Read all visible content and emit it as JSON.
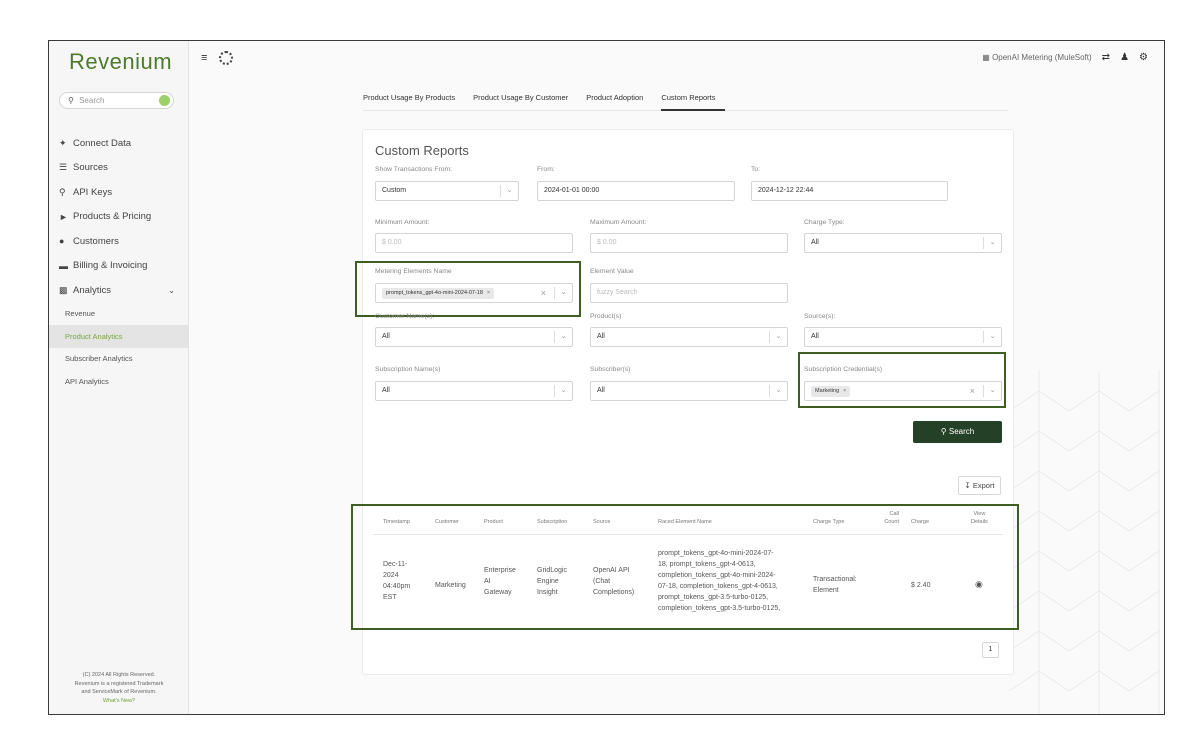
{
  "sidebar": {
    "logo": "Revenium",
    "search_placeholder": "Search",
    "items": [
      {
        "label": "Connect Data",
        "icon": "plug-icon"
      },
      {
        "label": "Sources",
        "icon": "database-icon"
      },
      {
        "label": "API Keys",
        "icon": "key-icon"
      },
      {
        "label": "Products & Pricing",
        "icon": "tag-icon"
      },
      {
        "label": "Customers",
        "icon": "users-icon"
      },
      {
        "label": "Billing & Invoicing",
        "icon": "credit-card-icon"
      },
      {
        "label": "Analytics",
        "icon": "bar-chart-icon"
      }
    ],
    "subitems": [
      {
        "label": "Revenue"
      },
      {
        "label": "Product Analytics",
        "active": true
      },
      {
        "label": "Subscriber Analytics"
      },
      {
        "label": "API Analytics"
      }
    ],
    "footer": {
      "line1": "(C) 2024 All Rights Reserved.",
      "line2": "Revenium is a registered Trademark",
      "line3": "and ServiceMark of Revenium.",
      "whats_new": "What's New?"
    }
  },
  "topbar": {
    "org_label": "OpenAI Metering (MuleSoft)"
  },
  "tabs": [
    {
      "label": "Product Usage By Products"
    },
    {
      "label": "Product Usage By Customer"
    },
    {
      "label": "Product Adoption"
    },
    {
      "label": "Custom Reports",
      "active": true
    }
  ],
  "report": {
    "title": "Custom Reports",
    "show_from_label": "Show Transactions From:",
    "show_from_value": "Custom",
    "from_label": "From:",
    "from_value": "2024-01-01 00:00",
    "to_label": "To:",
    "to_value": "2024-12-12 22:44",
    "min_label": "Minimum Amount:",
    "min_placeholder": "$ 0.00",
    "max_label": "Maximum Amount:",
    "max_placeholder": "$ 0.00",
    "charge_type_label": "Charge Type:",
    "charge_type_value": "All",
    "metering_label": "Metering Elements Name",
    "metering_chip": "prompt_tokens_gpt-4o-mini-2024-07-18",
    "element_value_label": "Element Value",
    "element_value_placeholder": "fuzzy Search",
    "customer_label": "Customer Name(s):",
    "customer_value": "All",
    "product_label": "Product(s)",
    "product_value": "All",
    "source_label": "Source(s):",
    "source_value": "All",
    "subscription_label": "Subscription Name(s)",
    "subscription_value": "All",
    "subscriber_label": "Subscriber(s)",
    "subscriber_value": "All",
    "credential_label": "Subscription Credential(s)",
    "credential_chip": "Marketing",
    "search_button": "Search",
    "export_button": "Export"
  },
  "table": {
    "headers": {
      "timestamp": "Timestamp",
      "customer": "Customer",
      "product": "Product",
      "subscription": "Subscription",
      "source": "Source",
      "raced": "Raced Element Name",
      "charge_type": "Charge Type",
      "call_count_1": "Call",
      "call_count_2": "Count",
      "charge": "Charge",
      "view_1": "View",
      "view_2": "Details"
    },
    "row": {
      "timestamp": [
        "Dec-11-",
        "2024",
        "04:40pm",
        "EST"
      ],
      "customer": "Marketing",
      "product": [
        "Enterprise",
        "AI",
        "Gateway"
      ],
      "subscription": [
        "GridLogic",
        "Engine",
        "Insight"
      ],
      "source": [
        "OpenAI API",
        "(Chat",
        "Completions)"
      ],
      "raced": [
        "prompt_tokens_gpt-4o-mini-2024-07-",
        "18, prompt_tokens_gpt-4-0613,",
        "completion_tokens_gpt-4o-mini-2024-",
        "07-18, completion_tokens_gpt-4-0613,",
        "prompt_tokens_gpt-3.5-turbo-0125,",
        "completion_tokens_gpt-3.5-turbo-0125,"
      ],
      "charge_type": [
        "Transactional:",
        "Element"
      ],
      "charge": "$ 2.40"
    },
    "page": "1"
  }
}
